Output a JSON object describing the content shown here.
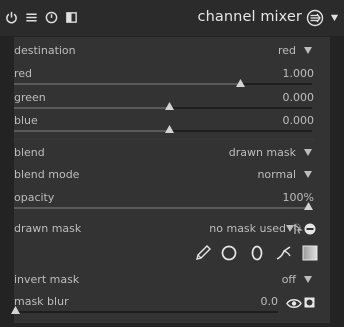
{
  "header": {
    "title": "channel mixer",
    "icons": [
      "power-icon",
      "multi-instance-icon",
      "reset-icon",
      "presets-icon"
    ]
  },
  "params": {
    "destination": {
      "label": "destination",
      "value": "red"
    },
    "red": {
      "label": "red",
      "value": "1.000",
      "level": 1.0
    },
    "green": {
      "label": "green",
      "value": "0.000",
      "level": 0.0
    },
    "blue": {
      "label": "blue",
      "value": "0.000",
      "level": 0.0
    }
  },
  "blend": {
    "blend": {
      "label": "blend",
      "value": "drawn mask"
    },
    "blend_mode": {
      "label": "blend mode",
      "value": "normal"
    },
    "opacity": {
      "label": "opacity",
      "value": "100%",
      "level": 1.0
    },
    "drawn_mask": {
      "label": "drawn mask",
      "value": "no mask used"
    },
    "shape_tools": [
      "brush-icon",
      "circle-icon",
      "ellipse-icon",
      "path-icon",
      "gradient-icon"
    ],
    "invert_mask": {
      "label": "invert mask",
      "value": "off"
    },
    "mask_blur": {
      "label": "mask blur",
      "value": "0.0",
      "level": 0.0
    }
  },
  "colors": {
    "background": "#232323",
    "panel": "#333333",
    "text": "#bdbdbd",
    "title": "#e6e6e6"
  }
}
